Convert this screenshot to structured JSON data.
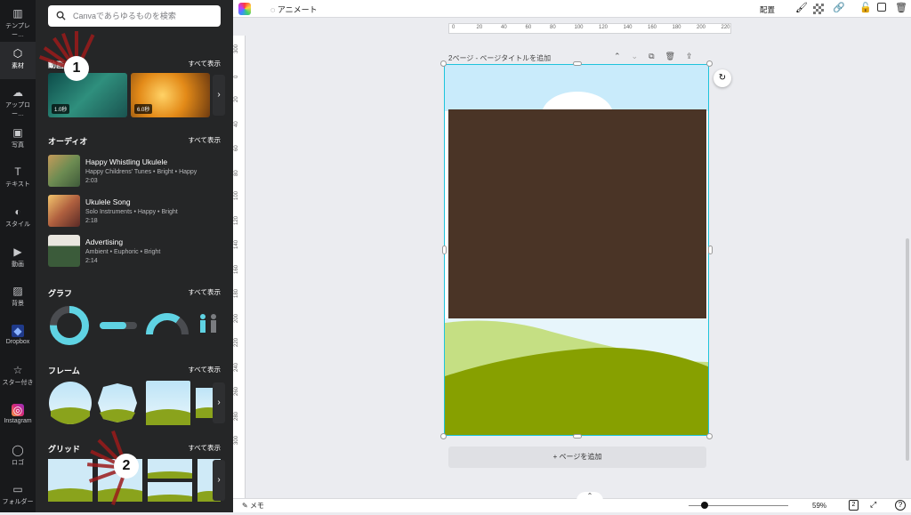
{
  "search": {
    "placeholder": "Canvaであらゆるものを検索"
  },
  "rail": [
    {
      "label": "テンプレー…",
      "icon": "template-icon"
    },
    {
      "label": "素材",
      "icon": "elements-icon"
    },
    {
      "label": "アップロー…",
      "icon": "upload-icon"
    },
    {
      "label": "写真",
      "icon": "photo-icon"
    },
    {
      "label": "テキスト",
      "icon": "text-icon"
    },
    {
      "label": "スタイル",
      "icon": "style-icon"
    },
    {
      "label": "動画",
      "icon": "video-icon"
    },
    {
      "label": "背景",
      "icon": "background-icon"
    },
    {
      "label": "Dropbox",
      "icon": "dropbox-icon"
    },
    {
      "label": "スター付き",
      "icon": "star-icon"
    },
    {
      "label": "Instagram",
      "icon": "instagram-icon"
    },
    {
      "label": "ロゴ",
      "icon": "logo-icon"
    },
    {
      "label": "フォルダー",
      "icon": "folder-icon"
    }
  ],
  "panel": {
    "video": {
      "title": "動画",
      "show_all": "すべて表示",
      "durations": [
        "1.0秒",
        "6.0秒"
      ]
    },
    "audio": {
      "title": "オーディオ",
      "show_all": "すべて表示",
      "items": [
        {
          "title": "Happy Whistling Ukulele",
          "meta": "Happy Childrens' Tunes • Bright • Happy",
          "duration": "2:03"
        },
        {
          "title": "Ukulele Song",
          "meta": "Solo Instruments • Happy • Bright",
          "duration": "2:18"
        },
        {
          "title": "Advertising",
          "meta": "Ambient • Euphoric • Bright",
          "duration": "2:14"
        }
      ]
    },
    "graph": {
      "title": "グラフ",
      "show_all": "すべて表示"
    },
    "frame": {
      "title": "フレーム",
      "show_all": "すべて表示"
    },
    "grid": {
      "title": "グリッド",
      "show_all": "すべて表示"
    }
  },
  "topbar": {
    "animate": "アニメート",
    "arrange": "配置"
  },
  "ruler_h": [
    "0",
    "20",
    "40",
    "60",
    "80",
    "100",
    "120",
    "140",
    "160",
    "180",
    "200",
    "220"
  ],
  "ruler_v": [
    "300",
    "0",
    "20",
    "40",
    "60",
    "80",
    "100",
    "120",
    "140",
    "160",
    "180",
    "200",
    "220",
    "240",
    "260",
    "280",
    "300"
  ],
  "page": {
    "label": "2ページ - ページタイトルを追加",
    "add_page": "+ ページを追加"
  },
  "bottombar": {
    "notes": "メモ",
    "zoom": "59%",
    "page_count": "2"
  },
  "annotations": [
    "1",
    "2"
  ],
  "colors": {
    "accent": "#1ec3dc",
    "brown": "#4a3426",
    "sky": "#c9ebfb",
    "grass_dark": "#87a000",
    "grass_light": "#c5df83",
    "annotation": "#9b1b1b"
  }
}
